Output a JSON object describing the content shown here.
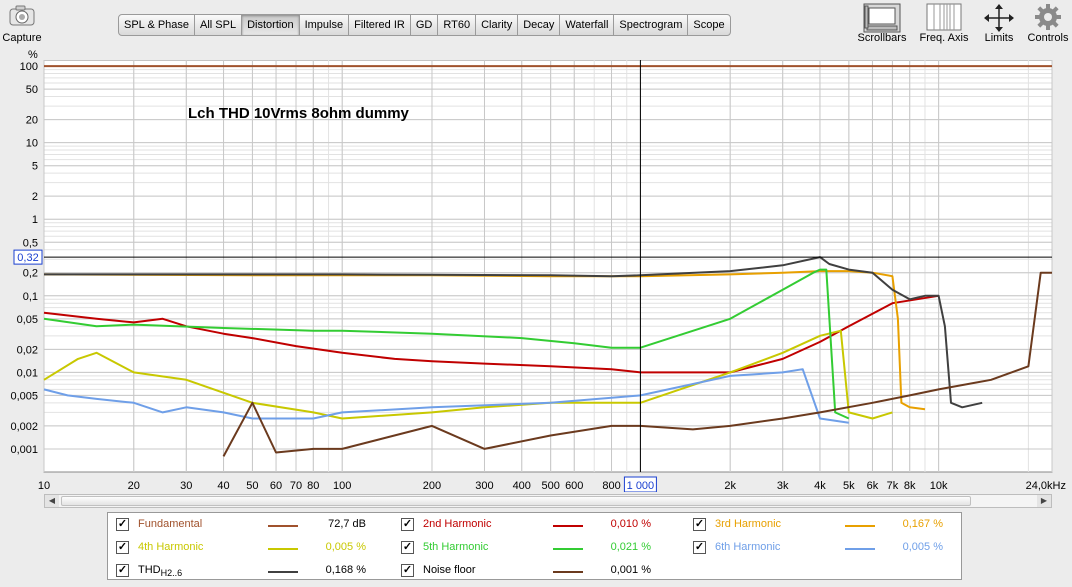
{
  "capture": {
    "label": "Capture",
    "icon": "camera-icon"
  },
  "tabs": [
    {
      "label": "SPL & Phase",
      "active": false
    },
    {
      "label": "All SPL",
      "active": false
    },
    {
      "label": "Distortion",
      "active": true
    },
    {
      "label": "Impulse",
      "active": false
    },
    {
      "label": "Filtered IR",
      "active": false
    },
    {
      "label": "GD",
      "active": false
    },
    {
      "label": "RT60",
      "active": false
    },
    {
      "label": "Clarity",
      "active": false
    },
    {
      "label": "Decay",
      "active": false
    },
    {
      "label": "Waterfall",
      "active": false
    },
    {
      "label": "Spectrogram",
      "active": false
    },
    {
      "label": "Scope",
      "active": false
    }
  ],
  "right_tools": {
    "scrollbars": "Scrollbars",
    "freq_axis": "Freq. Axis",
    "limits": "Limits",
    "controls": "Controls"
  },
  "chart_data": {
    "type": "line",
    "title": "Lch THD 10Vrms 8ohm dummy",
    "yunit": "%",
    "xunit": "kHz",
    "log_x": true,
    "log_y": true,
    "xlim": [
      10,
      24000
    ],
    "ylim": [
      0.0005,
      120
    ],
    "x_ticks": [
      "10",
      "20",
      "30",
      "40",
      "50",
      "60",
      "70",
      "80",
      "100",
      "200",
      "300",
      "400",
      "500",
      "600",
      "800",
      "1 000",
      "2k",
      "3k",
      "4k",
      "5k",
      "6k",
      "7k",
      "8k",
      "10k",
      "24,0kHz"
    ],
    "y_ticks": [
      "100",
      "50",
      "20",
      "10",
      "5",
      "2",
      "1",
      "0,5",
      "0,2",
      "0,1",
      "0,05",
      "0,02",
      "0,01",
      "0,005",
      "0,002",
      "0,001"
    ],
    "cursor": {
      "x_label": "1 000",
      "y_label": "0,32"
    },
    "colors": {
      "fundamental": "#a0522d",
      "h2": "#c00000",
      "h3": "#e8a000",
      "h4": "#c8c800",
      "h5": "#33cc33",
      "h6": "#6f9fe8",
      "thd": "#404040",
      "noise": "#6b3a1e"
    },
    "series": [
      {
        "name": "Fundamental",
        "x": [
          10,
          24000
        ],
        "y": [
          100,
          100
        ]
      },
      {
        "name": "2nd Harmonic",
        "x": [
          10,
          15,
          20,
          25,
          30,
          40,
          50,
          70,
          100,
          150,
          200,
          300,
          500,
          800,
          1000,
          2000,
          3000,
          4000,
          5000,
          7000,
          10000
        ],
        "y": [
          0.06,
          0.05,
          0.045,
          0.05,
          0.04,
          0.032,
          0.028,
          0.022,
          0.018,
          0.015,
          0.014,
          0.013,
          0.012,
          0.011,
          0.01,
          0.01,
          0.015,
          0.025,
          0.04,
          0.08,
          0.1
        ]
      },
      {
        "name": "3rd Harmonic",
        "x": [
          10,
          50,
          100,
          200,
          500,
          1000,
          2000,
          3000,
          4000,
          5000,
          6000,
          7000,
          7300,
          7500,
          8000,
          9000
        ],
        "y": [
          0.19,
          0.185,
          0.185,
          0.185,
          0.18,
          0.18,
          0.19,
          0.2,
          0.21,
          0.21,
          0.2,
          0.18,
          0.05,
          0.004,
          0.0035,
          0.0033
        ]
      },
      {
        "name": "4th Harmonic",
        "x": [
          10,
          13,
          15,
          20,
          30,
          50,
          80,
          100,
          200,
          300,
          500,
          800,
          1000,
          2000,
          3000,
          4000,
          4700,
          5000,
          6000,
          7000
        ],
        "y": [
          0.008,
          0.015,
          0.018,
          0.01,
          0.008,
          0.004,
          0.003,
          0.0025,
          0.003,
          0.0035,
          0.004,
          0.004,
          0.004,
          0.01,
          0.018,
          0.03,
          0.035,
          0.003,
          0.0025,
          0.003
        ]
      },
      {
        "name": "5th Harmonic",
        "x": [
          10,
          15,
          20,
          40,
          80,
          100,
          200,
          400,
          600,
          800,
          1000,
          2000,
          3000,
          3800,
          4000,
          4200,
          4500,
          5000
        ],
        "y": [
          0.05,
          0.04,
          0.042,
          0.038,
          0.035,
          0.035,
          0.032,
          0.028,
          0.024,
          0.021,
          0.021,
          0.05,
          0.12,
          0.2,
          0.22,
          0.22,
          0.003,
          0.0025
        ]
      },
      {
        "name": "6th Harmonic",
        "x": [
          10,
          12,
          15,
          20,
          25,
          30,
          40,
          50,
          80,
          100,
          200,
          500,
          1000,
          2000,
          3000,
          3500,
          4000,
          5000
        ],
        "y": [
          0.006,
          0.005,
          0.0045,
          0.004,
          0.003,
          0.0035,
          0.003,
          0.0025,
          0.0025,
          0.003,
          0.0035,
          0.004,
          0.005,
          0.009,
          0.01,
          0.011,
          0.0025,
          0.0022
        ]
      },
      {
        "name": "THD H2..6",
        "x": [
          10,
          50,
          100,
          200,
          500,
          800,
          1000,
          2000,
          3000,
          4000,
          4300,
          5000,
          6000,
          7000,
          8000,
          9000,
          10000,
          10500,
          11000,
          12000,
          14000
        ],
        "y": [
          0.19,
          0.19,
          0.19,
          0.188,
          0.185,
          0.18,
          0.185,
          0.21,
          0.25,
          0.32,
          0.26,
          0.22,
          0.2,
          0.12,
          0.09,
          0.1,
          0.1,
          0.04,
          0.004,
          0.0035,
          0.004
        ]
      },
      {
        "name": "Noise floor",
        "x": [
          40,
          50,
          60,
          80,
          100,
          200,
          300,
          500,
          800,
          1000,
          1500,
          2000,
          3000,
          4000,
          6000,
          8000,
          10000,
          15000,
          20000,
          22000,
          24000
        ],
        "y": [
          0.0008,
          0.004,
          0.0009,
          0.001,
          0.001,
          0.002,
          0.001,
          0.0015,
          0.002,
          0.002,
          0.0018,
          0.002,
          0.0025,
          0.003,
          0.004,
          0.005,
          0.006,
          0.008,
          0.012,
          0.2,
          0.2
        ]
      }
    ]
  },
  "legend": [
    {
      "name": "Fundamental",
      "value": "72,7 dB",
      "color": "#a0522d",
      "checked": true
    },
    {
      "name": "2nd Harmonic",
      "value": "0,010 %",
      "color": "#c00000",
      "checked": true
    },
    {
      "name": "3rd Harmonic",
      "value": "0,167 %",
      "color": "#e8a000",
      "checked": true
    },
    {
      "name": "4th Harmonic",
      "value": "0,005 %",
      "color": "#c8c800",
      "checked": true
    },
    {
      "name": "5th Harmonic",
      "value": "0,021 %",
      "color": "#33cc33",
      "checked": true
    },
    {
      "name": "6th Harmonic",
      "value": "0,005 %",
      "color": "#6f9fe8",
      "checked": true
    },
    {
      "name": "THD",
      "sub": "H2..6",
      "value": "0,168 %",
      "color": "#404040",
      "checked": true
    },
    {
      "name": "Noise floor",
      "value": "0,001 %",
      "color": "#6b3a1e",
      "checked": true
    }
  ]
}
